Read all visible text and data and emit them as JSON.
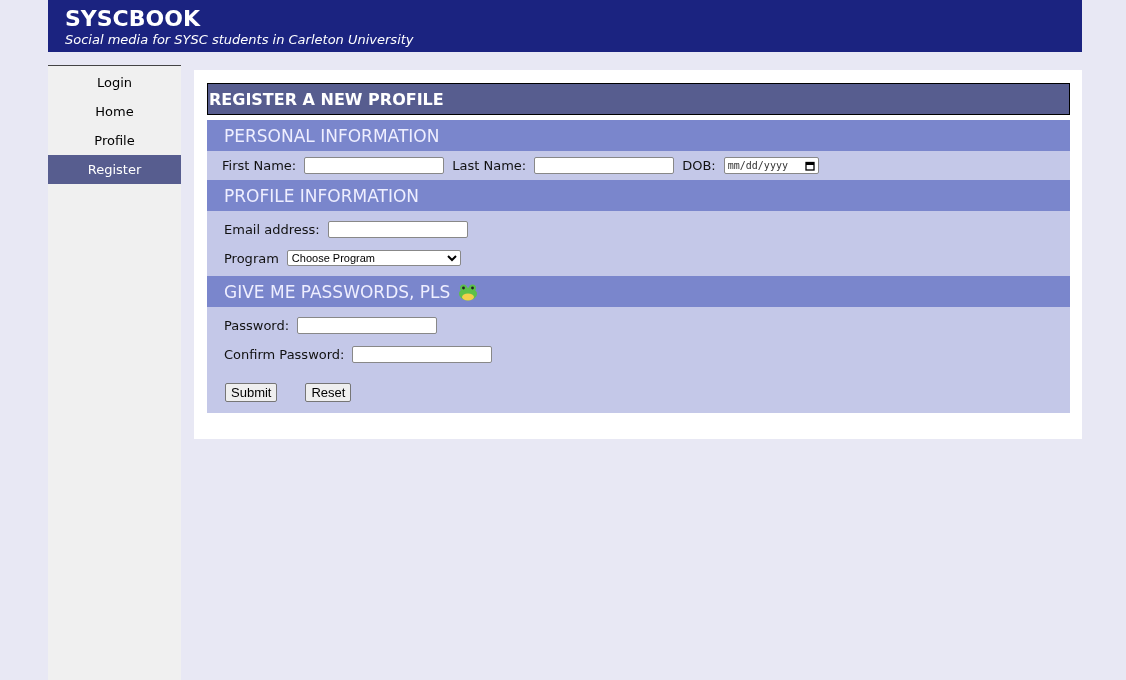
{
  "header": {
    "title": "SYSCBOOK",
    "subtitle": "Social media for SYSC students in Carleton University"
  },
  "nav": [
    {
      "label": "Login",
      "selected": false
    },
    {
      "label": "Home",
      "selected": false
    },
    {
      "label": "Profile",
      "selected": false
    },
    {
      "label": "Register",
      "selected": true
    }
  ],
  "page_title": "REGISTER A NEW PROFILE",
  "sections": [
    {
      "heading": "PERSONAL INFORMATION",
      "kind": "inline",
      "icon": false,
      "fields": [
        {
          "kind": "text",
          "label": "First Name:"
        },
        {
          "kind": "text",
          "label": "Last Name:"
        },
        {
          "kind": "date",
          "label": "DOB:",
          "placeholder": "mm/dd/yyyy"
        }
      ]
    },
    {
      "heading": "PROFILE INFORMATION",
      "kind": "stacked",
      "icon": false,
      "fields": [
        {
          "kind": "text",
          "label": "Email address:"
        },
        {
          "kind": "select",
          "label": "Program",
          "value": "Choose Program"
        }
      ]
    },
    {
      "heading": "GIVE ME PASSWORDS, PLS",
      "kind": "stacked",
      "icon": true,
      "fields": [
        {
          "kind": "text",
          "label": "Password:"
        },
        {
          "kind": "text",
          "label": "Confirm Password:"
        }
      ]
    }
  ],
  "buttons": [
    "Submit",
    "Reset"
  ]
}
